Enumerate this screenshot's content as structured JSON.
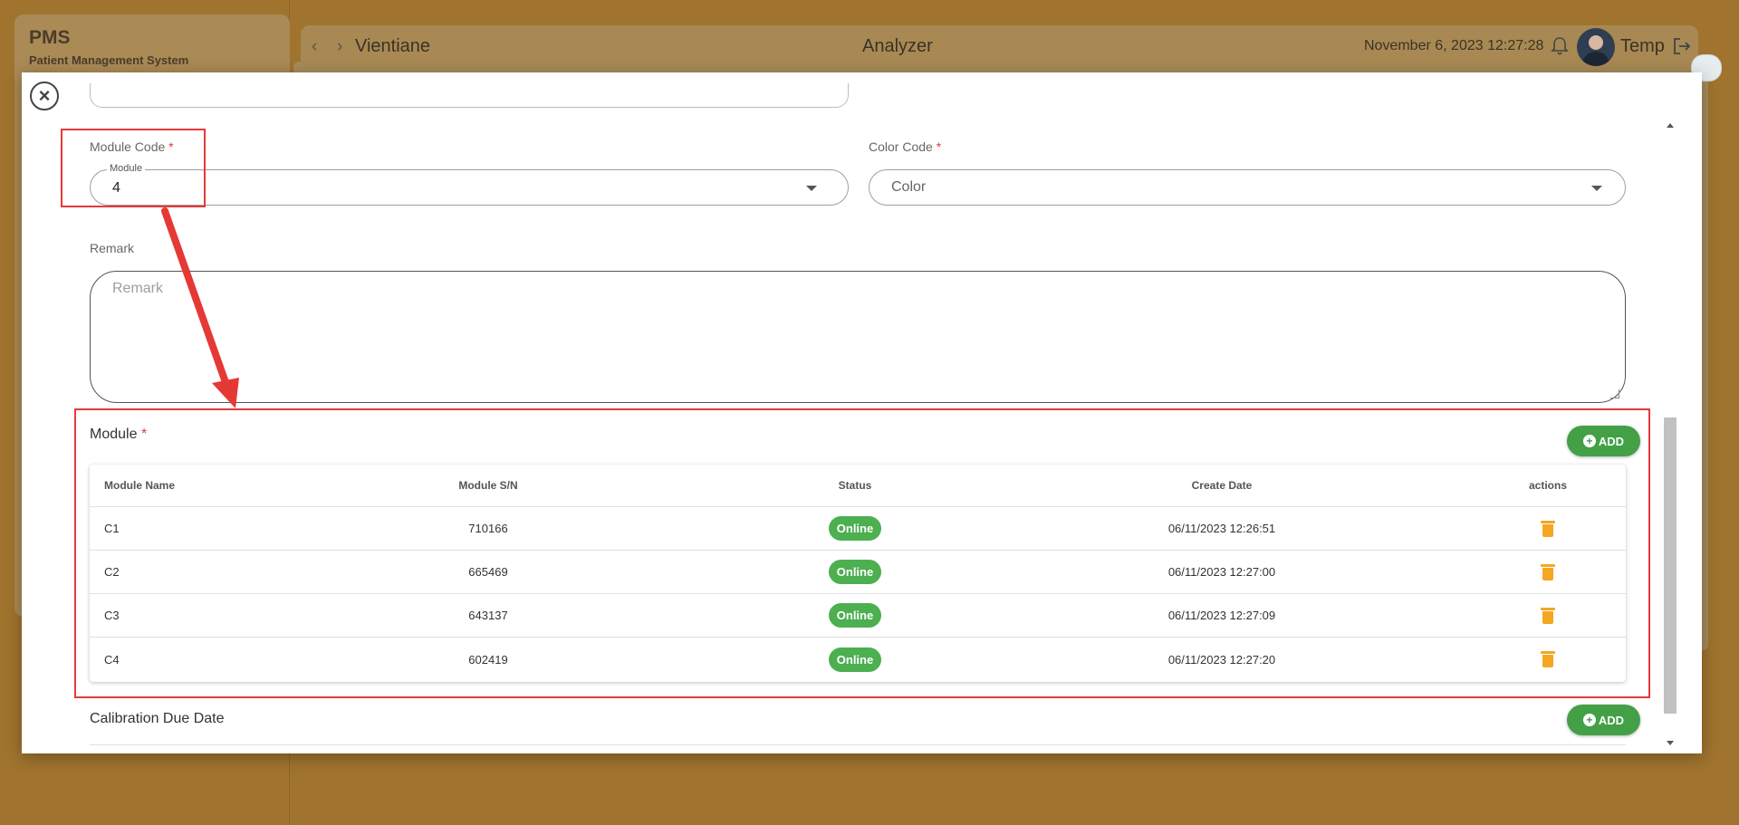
{
  "background_app": {
    "brand_title": "PMS",
    "brand_subtitle": "Patient Management System",
    "nav_prev": "‹",
    "nav_next": "›",
    "location": "Vientiane",
    "page_title": "Analyzer",
    "datetime": "November 6, 2023 12:27:28",
    "user_name": "Temp"
  },
  "modal": {
    "close_symbol": "×",
    "module_code": {
      "label": "Module Code",
      "required_mark": "*",
      "legend": "Module",
      "value": "4"
    },
    "color_code": {
      "label": "Color Code",
      "required_mark": "*",
      "placeholder": "Color"
    },
    "remark": {
      "label": "Remark",
      "placeholder": "Remark"
    },
    "module_section": {
      "title": "Module",
      "required_mark": "*",
      "add_label": "ADD",
      "columns": [
        "Module Name",
        "Module S/N",
        "Status",
        "Create Date",
        "actions"
      ],
      "rows": [
        {
          "name": "C1",
          "sn": "710166",
          "status": "Online",
          "created": "06/11/2023 12:26:51"
        },
        {
          "name": "C2",
          "sn": "665469",
          "status": "Online",
          "created": "06/11/2023 12:27:00"
        },
        {
          "name": "C3",
          "sn": "643137",
          "status": "Online",
          "created": "06/11/2023 12:27:09"
        },
        {
          "name": "C4",
          "sn": "602419",
          "status": "Online",
          "created": "06/11/2023 12:27:20"
        }
      ]
    },
    "calibration_section": {
      "title": "Calibration Due Date",
      "add_label": "ADD"
    }
  },
  "colors": {
    "accent_green": "#43a047",
    "status_online": "#4caf50",
    "trash_icon": "#f5a623",
    "annotation_red": "#e53935"
  }
}
